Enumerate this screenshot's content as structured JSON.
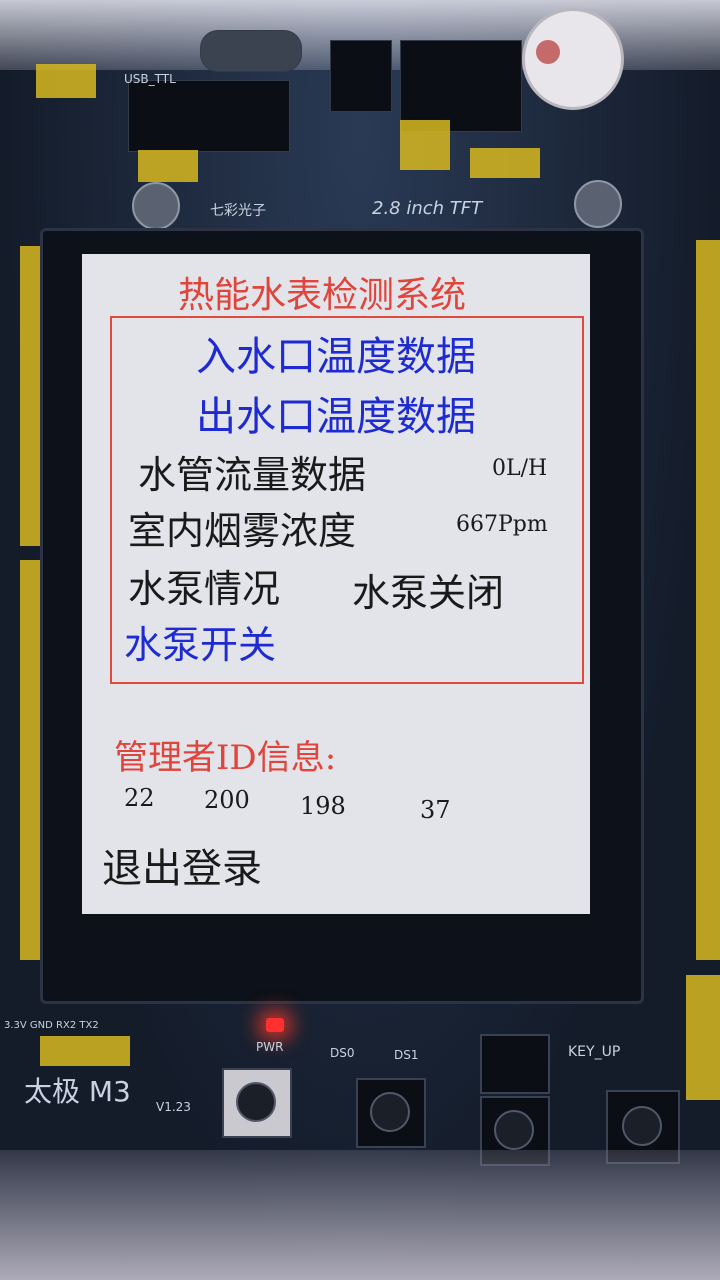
{
  "lcd": {
    "title": "热能水表检测系统",
    "menu": {
      "inlet_temp": "入水口温度数据",
      "outlet_temp": "出水口温度数据",
      "flow_label": "水管流量数据",
      "flow_value": "0L/H",
      "smoke_label": "室内烟雾浓度",
      "smoke_value": "667Ppm",
      "pump_status_label": "水泵情况",
      "pump_status_value": "水泵关闭",
      "pump_switch": "水泵开关"
    },
    "admin": {
      "label": "管理者ID信息:",
      "id_parts": [
        "22",
        "200",
        "198",
        "37"
      ]
    },
    "logout": "退出登录"
  },
  "board": {
    "name": "太极 M3",
    "version": "V1.23",
    "brand": "七彩光子",
    "screen_size": "2.8 inch TFT",
    "usb_label": "USB_TTL",
    "pwr_label": "PWR",
    "ds0_label": "DS0",
    "ds1_label": "DS1",
    "key_up_label": "KEY_UP",
    "header_pins": "3.3V GND RX2 TX2"
  },
  "colors": {
    "title_red": "#e0443a",
    "menu_blue": "#1e2bd0",
    "text_black": "#1a1a1a",
    "lcd_bg": "#e2e4ea",
    "frame_red": "#e04a3a"
  }
}
